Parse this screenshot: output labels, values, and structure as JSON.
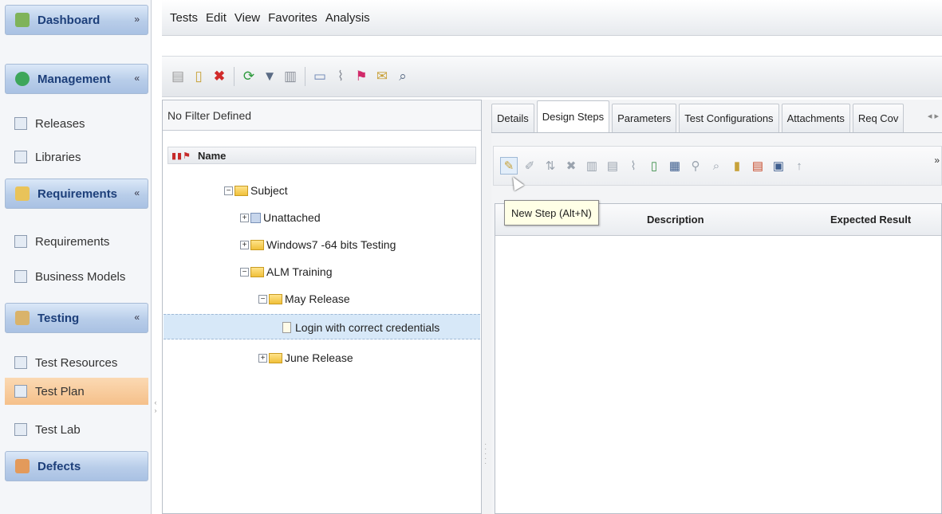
{
  "sidebar": {
    "groups": [
      {
        "label": "Dashboard",
        "chevron": "»"
      },
      {
        "label": "Management",
        "chevron": "«"
      },
      {
        "label": "Requirements",
        "chevron": "«"
      },
      {
        "label": "Testing",
        "chevron": "«"
      },
      {
        "label": "Defects"
      }
    ],
    "items": {
      "releases": "Releases",
      "libraries": "Libraries",
      "requirements": "Requirements",
      "business_models": "Business Models",
      "test_resources": "Test Resources",
      "test_plan": "Test Plan",
      "test_lab": "Test Lab"
    }
  },
  "menu": [
    "Tests",
    "Edit",
    "View",
    "Favorites",
    "Analysis"
  ],
  "tree": {
    "filter_text": "No Filter Defined",
    "header_name": "Name",
    "nodes": {
      "subject": "Subject",
      "unattached": "Unattached",
      "windows7": "Windows7 -64 bits Testing",
      "alm_training": "ALM Training",
      "may_release": "May Release",
      "login_test": "Login with correct credentials",
      "june_release": "June Release"
    }
  },
  "detail": {
    "tabs": [
      "Details",
      "Design Steps",
      "Parameters",
      "Test Configurations",
      "Attachments",
      "Req Cov"
    ],
    "active_tab": "Design Steps",
    "tooltip": "New Step (Alt+N)",
    "columns": {
      "description": "Description",
      "expected_result": "Expected Result"
    }
  },
  "colors": {
    "accent": "#b8cde9",
    "active_item": "#f5c08a",
    "selection": "#d7e8f8"
  }
}
